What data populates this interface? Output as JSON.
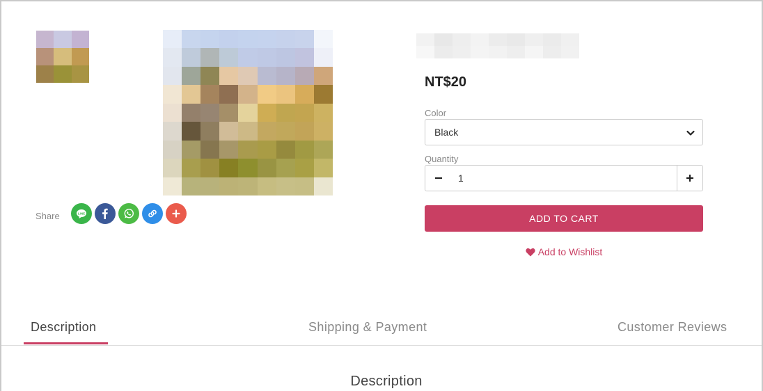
{
  "product": {
    "price": "NT$20",
    "color_label": "Color",
    "color_value": "Black",
    "quantity_label": "Quantity",
    "quantity_value": "1",
    "add_to_cart": "ADD TO CART",
    "wishlist": "Add to Wishlist"
  },
  "share": {
    "label": "Share",
    "buttons": [
      {
        "icon": "line-icon",
        "color": "#3ab54a"
      },
      {
        "icon": "facebook-icon",
        "color": "#3b5998"
      },
      {
        "icon": "whatsapp-icon",
        "color": "#4cbb45"
      },
      {
        "icon": "link-icon",
        "color": "#2f8ee8"
      },
      {
        "icon": "plus-icon",
        "color": "#ea5b4c"
      }
    ]
  },
  "tabs": [
    {
      "label": "Description",
      "active": true
    },
    {
      "label": "Shipping & Payment",
      "active": false
    },
    {
      "label": "Customer Reviews",
      "active": false
    }
  ],
  "section": {
    "title": "Description"
  },
  "colors": {
    "accent": "#c93f63"
  }
}
